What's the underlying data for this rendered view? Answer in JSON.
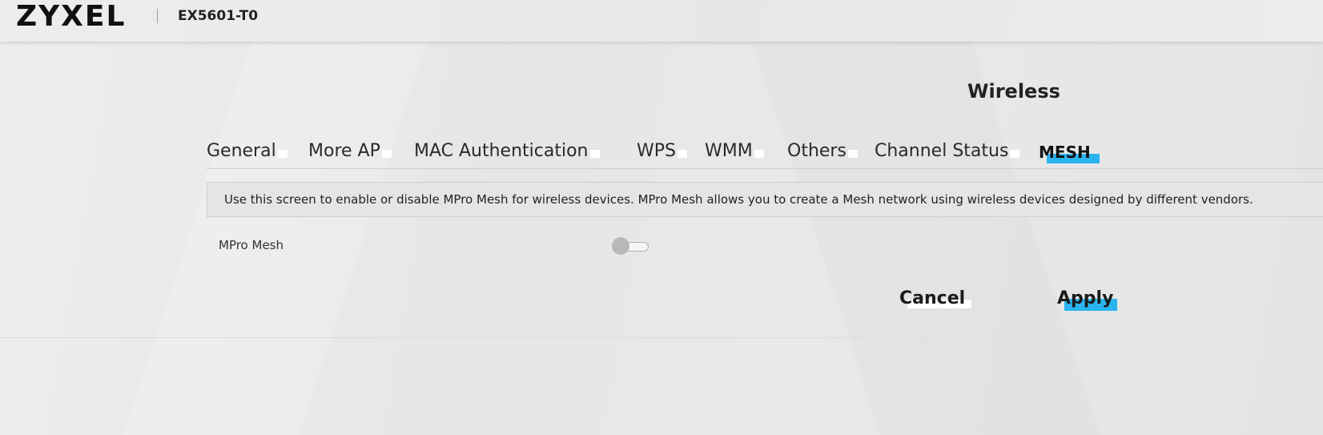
{
  "header": {
    "brand": "ZYXEL",
    "model": "EX5601-T0"
  },
  "page": {
    "title": "Wireless"
  },
  "tabs": [
    {
      "label": "General",
      "active": false
    },
    {
      "label": "More AP",
      "active": false
    },
    {
      "label": "MAC Authentication",
      "active": false
    },
    {
      "label": "WPS",
      "active": false
    },
    {
      "label": "WMM",
      "active": false
    },
    {
      "label": "Others",
      "active": false
    },
    {
      "label": "Channel Status",
      "active": false
    },
    {
      "label": "MESH",
      "active": true
    }
  ],
  "info": {
    "text": "Use this screen to enable or disable MPro Mesh for wireless devices. MPro Mesh allows you to create a Mesh network using wireless devices designed by different vendors."
  },
  "settings": {
    "mpro_mesh_label": "MPro Mesh",
    "mpro_mesh_enabled": false
  },
  "actions": {
    "cancel_label": "Cancel",
    "apply_label": "Apply"
  },
  "colors": {
    "accent": "#2ab4ef",
    "background": "#e9e9e9",
    "toggle_off": "#b8b8b8"
  }
}
